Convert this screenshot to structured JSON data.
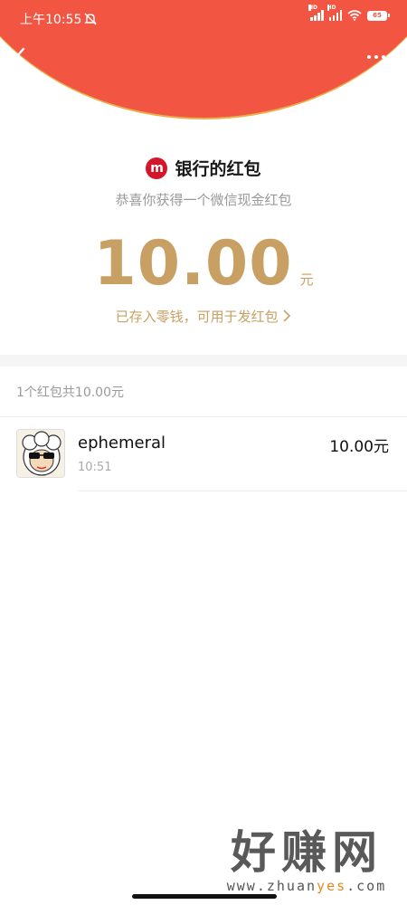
{
  "status_bar": {
    "time": "上午10:55",
    "battery": "65",
    "signal_label": "HD"
  },
  "header": {
    "back_icon": "chevron-left-icon",
    "more_icon": "more-dots-icon",
    "accent_color": "#f25643",
    "border_color": "#e8b04a"
  },
  "envelope": {
    "sender": "银行的红包",
    "greeting": "恭喜你获得一个微信现金红包",
    "amount": "10.00",
    "unit": "元",
    "deposit_note": "已存入零钱，可用于发红包",
    "gold_color": "#c8a063",
    "logo_color": "#d3172a"
  },
  "list": {
    "summary": "1个红包共10.00元",
    "records": [
      {
        "name": "ephemeral",
        "time": "10:51",
        "amount": "10.00元"
      }
    ]
  },
  "watermark": {
    "title": "好赚网",
    "url_prefix": "www.zhuan",
    "url_highlight": "yes",
    "url_suffix": ".com"
  }
}
